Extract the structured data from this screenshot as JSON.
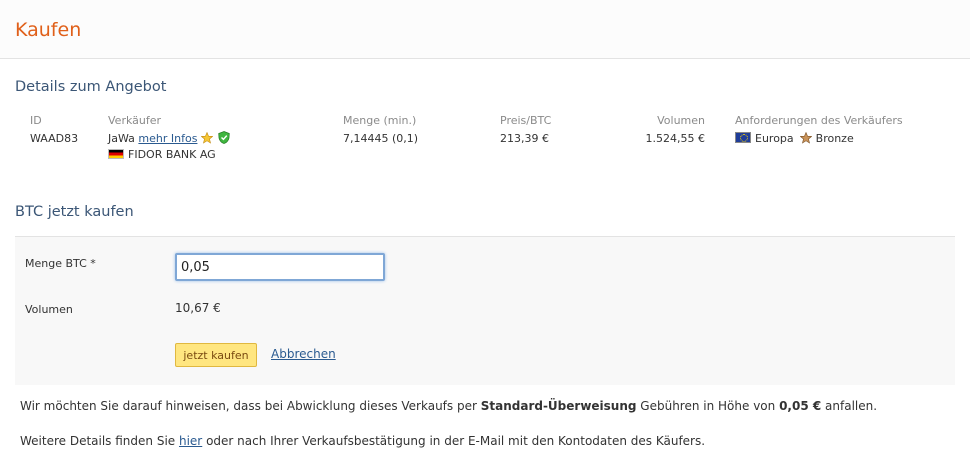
{
  "page": {
    "title": "Kaufen"
  },
  "offer_section": {
    "title": "Details zum Angebot",
    "headers": {
      "id": "ID",
      "seller": "Verkäufer",
      "amount": "Menge (min.)",
      "price": "Preis/BTC",
      "volume": "Volumen",
      "requirements": "Anforderungen des Verkäufers"
    },
    "row": {
      "id": "WAAD83",
      "seller_name": "JaWa",
      "seller_more_link": "mehr Infos",
      "seller_bank": "FIDOR BANK AG",
      "amount": "7,14445 (0,1)",
      "price": "213,39 €",
      "volume": "1.524,55 €",
      "req_region": "Europa",
      "req_level": "Bronze"
    }
  },
  "buy_section": {
    "title": "BTC jetzt kaufen",
    "amount_label": "Menge BTC *",
    "amount_value": "0,05",
    "volume_label": "Volumen",
    "volume_value": "10,67 €",
    "buy_button": "jetzt kaufen",
    "cancel_link": "Abbrechen"
  },
  "notes": {
    "fee_pre": "Wir möchten Sie darauf hinweisen, dass bei Abwicklung dieses Verkaufs per ",
    "fee_method": "Standard-Überweisung",
    "fee_mid": " Gebühren in Höhe von ",
    "fee_amount": "0,05 €",
    "fee_post": " anfallen.",
    "details_pre": "Weitere Details finden Sie ",
    "details_link": "hier",
    "details_post": " oder nach Ihrer Verkaufsbestätigung in der E-Mail mit den Kontodaten des Käufers."
  },
  "colors": {
    "title": "#e0601a",
    "section": "#3b5676",
    "link": "#2a5a90",
    "button": "#ffe680"
  }
}
